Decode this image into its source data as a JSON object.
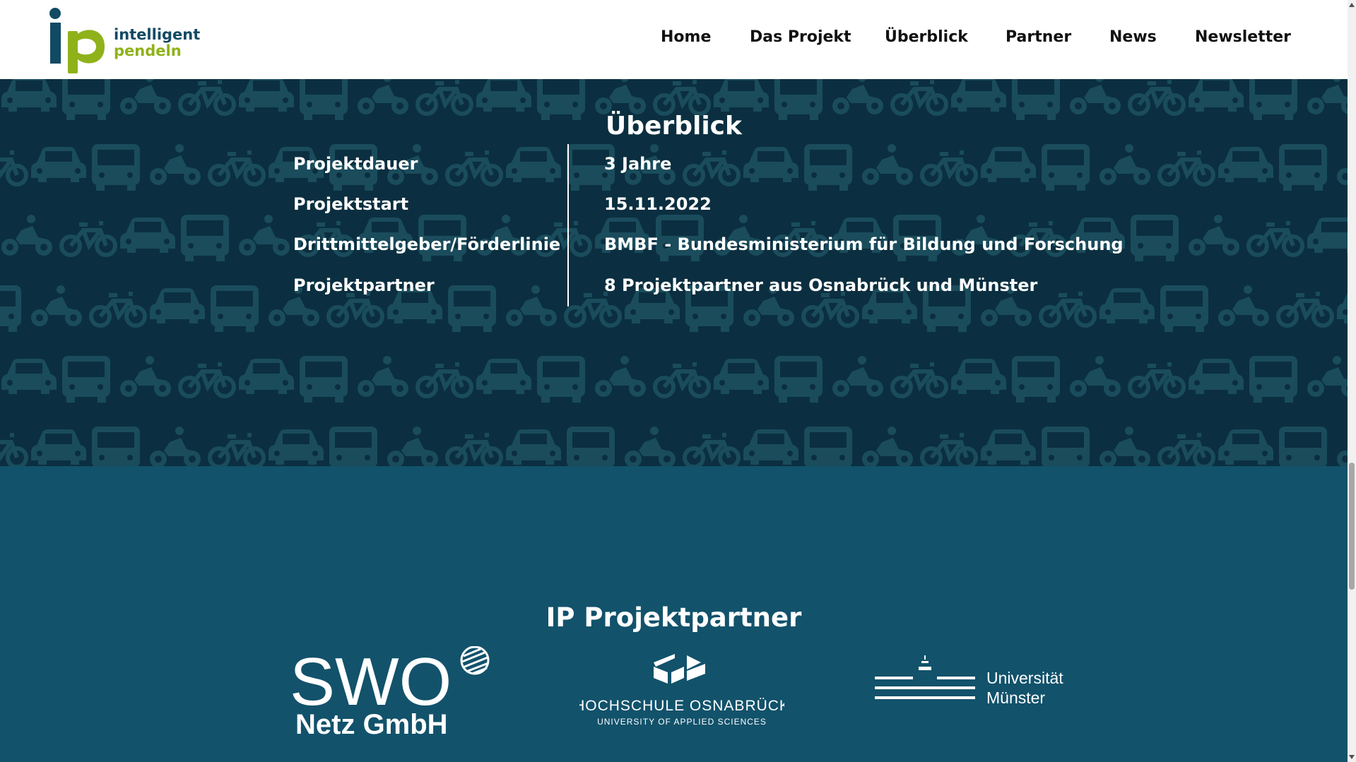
{
  "logo": {
    "line1": "intelligent",
    "line2": "pendeln",
    "icon": "ip-logo-icon"
  },
  "nav": {
    "items": [
      {
        "label": "Home"
      },
      {
        "label": "Das Projekt"
      },
      {
        "label": "Überblick"
      },
      {
        "label": "Partner"
      },
      {
        "label": "News"
      },
      {
        "label": "Newsletter"
      }
    ]
  },
  "overview": {
    "title": "Überblick",
    "rows": [
      {
        "label": "Projektdauer",
        "value": "3 Jahre"
      },
      {
        "label": "Projektstart",
        "value": "15.11.2022"
      },
      {
        "label": "Drittmittelgeber/Förderlinie",
        "value": "BMBF - Bundesministerium für Bildung und Forschung"
      },
      {
        "label": "Projektpartner",
        "value": "8 Projektpartner aus Osnabrück und Münster"
      }
    ],
    "pattern_icons": [
      "car-icon",
      "bus-icon",
      "motorbike-icon",
      "bicycle-icon"
    ]
  },
  "partners": {
    "title": "IP Projektpartner",
    "logos": [
      {
        "name": "SWO Netz GmbH",
        "line1": "SWO",
        "line2": "Netz GmbH"
      },
      {
        "name": "Hochschule Osnabrück",
        "line1": "HOCHSCHULE OSNABRÜCK",
        "line2": "UNIVERSITY OF APPLIED SCIENCES"
      },
      {
        "name": "Universität Münster",
        "line1": "Universität",
        "line2": "Münster"
      }
    ]
  },
  "colors": {
    "brand_teal": "#114a63",
    "brand_green": "#8fb21a",
    "overview_bg": "#0b2f40",
    "pattern_icon": "#1a4c5c",
    "partners_bg": "#12526b",
    "text_on_dark": "#ffffff"
  }
}
